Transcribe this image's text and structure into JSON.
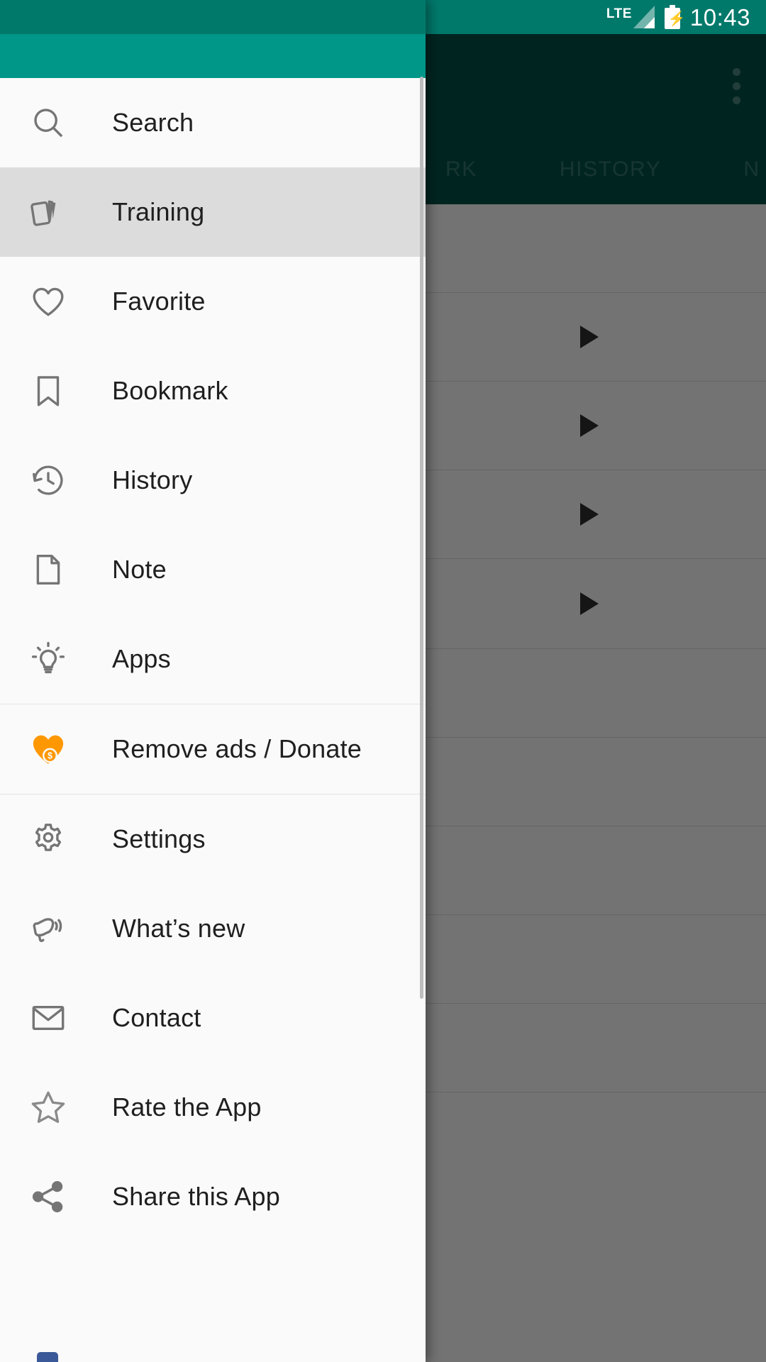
{
  "status_bar": {
    "network_label": "LTE",
    "time": "10:43",
    "battery_icon": "battery-charging-icon",
    "signal_icon": "signal-bars-icon"
  },
  "background_app": {
    "overflow_menu_icon": "overflow-menu-icon",
    "tabs": [
      {
        "label": "RK",
        "name": "tab-bookmark-partial"
      },
      {
        "label": "HISTORY",
        "name": "tab-history"
      },
      {
        "label": "N",
        "name": "tab-note-partial"
      }
    ],
    "list_rows": [
      {
        "play_icon": "play-icon"
      },
      {
        "play_icon": "play-icon"
      },
      {
        "play_icon": "play-icon"
      },
      {
        "play_icon": "play-icon"
      }
    ]
  },
  "drawer": {
    "header_color": "#009688",
    "background_color": "#FAFAFA",
    "selected_background": "#DCDCDC",
    "accent_donate_color": "#FF9800",
    "items": [
      {
        "label": "Search",
        "icon": "search-icon",
        "selected": false
      },
      {
        "label": "Training",
        "icon": "cards-icon",
        "selected": true
      },
      {
        "label": "Favorite",
        "icon": "heart-icon",
        "selected": false
      },
      {
        "label": "Bookmark",
        "icon": "bookmark-icon",
        "selected": false
      },
      {
        "label": "History",
        "icon": "history-icon",
        "selected": false
      },
      {
        "label": "Note",
        "icon": "document-icon",
        "selected": false
      },
      {
        "label": "Apps",
        "icon": "lightbulb-icon",
        "selected": false
      },
      {
        "label": "Remove ads / Donate",
        "icon": "heart-money-icon",
        "selected": false
      },
      {
        "label": "Settings",
        "icon": "gear-icon",
        "selected": false
      },
      {
        "label": "What’s new",
        "icon": "megaphone-icon",
        "selected": false
      },
      {
        "label": "Contact",
        "icon": "envelope-icon",
        "selected": false
      },
      {
        "label": "Rate the App",
        "icon": "star-icon",
        "selected": false
      },
      {
        "label": "Share this App",
        "icon": "share-icon",
        "selected": false
      }
    ]
  }
}
